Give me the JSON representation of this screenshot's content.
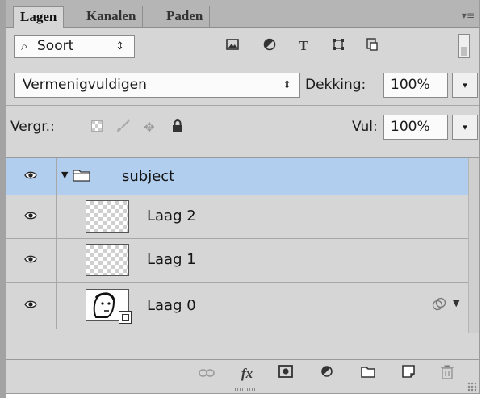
{
  "tabs": [
    "Lagen",
    "Kanalen",
    "Paden"
  ],
  "panel_menu_icon": "panel-menu-icon",
  "filter": {
    "search_icon": "⌕",
    "kind_label": "Soort",
    "arrows": "⇕",
    "filter_icons": [
      "image-filter-icon",
      "adjustment-filter-icon",
      "type-filter-icon",
      "shape-filter-icon",
      "smart-object-filter-icon"
    ]
  },
  "blend": {
    "mode": "Vermenigvuldigen",
    "arrows": "⇕",
    "opacity_label": "Dekking:",
    "opacity_value": "100%",
    "dropdown_glyph": "▾"
  },
  "lock": {
    "label": "Vergr.:",
    "fill_label": "Vul:",
    "fill_value": "100%",
    "dropdown_glyph": "▾",
    "lock_icons": [
      "lock-transparency-icon",
      "lock-pixels-icon",
      "lock-position-icon",
      "lock-all-icon"
    ]
  },
  "layers": [
    {
      "name": "subject",
      "type": "group",
      "selected": true,
      "expanded": true
    },
    {
      "name": "Laag 2",
      "type": "pixel",
      "selected": false
    },
    {
      "name": "Laag 1",
      "type": "pixel",
      "selected": false
    },
    {
      "name": "Laag 0",
      "type": "smart-object",
      "selected": false,
      "has_smart_filter_badge": true
    }
  ],
  "bottom_toolbar_icons": [
    "link-layers-icon",
    "fx-icon",
    "add-mask-icon",
    "new-adjustment-icon",
    "new-group-icon",
    "new-layer-icon",
    "delete-layer-icon"
  ],
  "colors": {
    "panel_bg": "#d6d6d6",
    "selected_row": "#b2ceee",
    "tab_strip": "#b5b5b5"
  }
}
